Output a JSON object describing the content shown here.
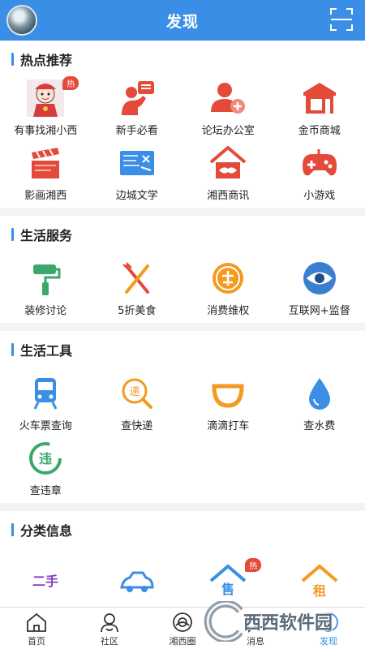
{
  "header": {
    "title": "发现"
  },
  "sections": {
    "hot": {
      "title": "热点推荐",
      "items": [
        {
          "label": "有事找湘小西",
          "icon": "mascot-icon",
          "badge": "热"
        },
        {
          "label": "新手必看",
          "icon": "newbie-guide-icon"
        },
        {
          "label": "论坛办公室",
          "icon": "forum-office-icon"
        },
        {
          "label": "金币商城",
          "icon": "coin-mall-icon"
        },
        {
          "label": "影画湘西",
          "icon": "clapperboard-icon"
        },
        {
          "label": "边城文学",
          "icon": "literature-icon"
        },
        {
          "label": "湘西商讯",
          "icon": "house-handshake-icon"
        },
        {
          "label": "小游戏",
          "icon": "gamepad-icon"
        }
      ]
    },
    "life": {
      "title": "生活服务",
      "items": [
        {
          "label": "装修讨论",
          "icon": "paint-roller-icon"
        },
        {
          "label": "5折美食",
          "icon": "fork-knife-icon"
        },
        {
          "label": "消费维权",
          "icon": "consumer-rights-icon"
        },
        {
          "label": "互联网+监督",
          "icon": "eye-icon"
        }
      ]
    },
    "tools": {
      "title": "生活工具",
      "items": [
        {
          "label": "火车票查询",
          "icon": "train-icon"
        },
        {
          "label": "查快递",
          "icon": "express-search-icon"
        },
        {
          "label": "滴滴打车",
          "icon": "didi-icon"
        },
        {
          "label": "查水费",
          "icon": "water-drop-icon"
        },
        {
          "label": "查违章",
          "icon": "violation-icon"
        }
      ]
    },
    "category": {
      "title": "分类信息",
      "items": [
        {
          "label": "二手",
          "icon": "second-hand-icon"
        },
        {
          "label": "",
          "icon": "car-icon"
        },
        {
          "label": "售",
          "icon": "house-sale-icon",
          "badge": "热"
        },
        {
          "label": "租",
          "icon": "house-rent-icon"
        }
      ]
    }
  },
  "tabbar": [
    {
      "label": "首页",
      "icon": "home-icon"
    },
    {
      "label": "社区",
      "icon": "community-icon"
    },
    {
      "label": "湘西圈",
      "icon": "circle-icon"
    },
    {
      "label": "消息",
      "icon": "message-icon"
    },
    {
      "label": "发现",
      "icon": "discover-icon"
    }
  ],
  "watermark": "西西软件园",
  "colors": {
    "brand": "#3a8ee6",
    "accent_red": "#e34a3a",
    "orange": "#f39a1f",
    "green": "#3aa86b"
  }
}
